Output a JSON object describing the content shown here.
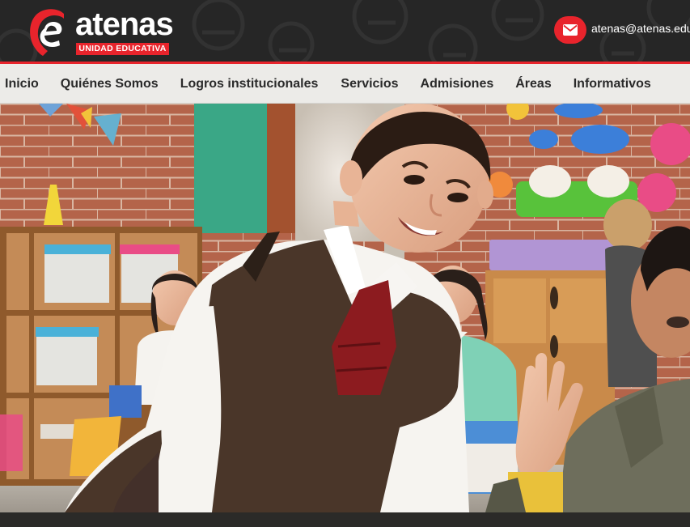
{
  "header": {
    "logo_word": "atenas",
    "logo_tagline": "UNIDAD EDUCATIVA",
    "contact_email": "atenas@atenas.edu",
    "mail_icon": "envelope-icon"
  },
  "nav": {
    "items": [
      {
        "label": "Inicio"
      },
      {
        "label": "Quiénes Somos"
      },
      {
        "label": "Logros institucionales"
      },
      {
        "label": "Servicios"
      },
      {
        "label": "Admisiones"
      },
      {
        "label": "Áreas"
      },
      {
        "label": "Informativos"
      }
    ]
  },
  "colors": {
    "brand_red": "#e8242c",
    "header_bg": "#262626",
    "nav_bg": "#ecebe8"
  }
}
